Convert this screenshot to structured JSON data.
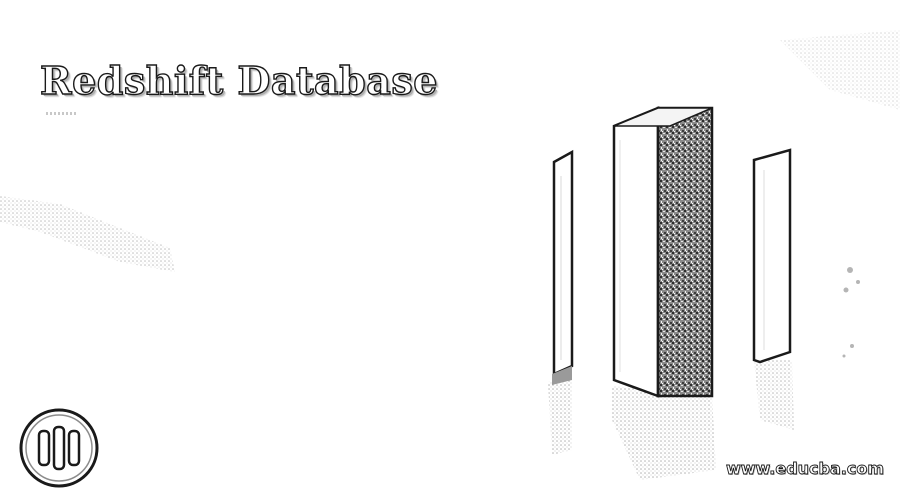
{
  "banner": {
    "title": "Redshift Database",
    "site_url": "www.educba.com"
  },
  "icons": {
    "logo": "educba-logo-icon",
    "illustration": "server-racks-illustration"
  },
  "colors": {
    "background": "#ffffff",
    "outline": "#1a1a1a"
  }
}
